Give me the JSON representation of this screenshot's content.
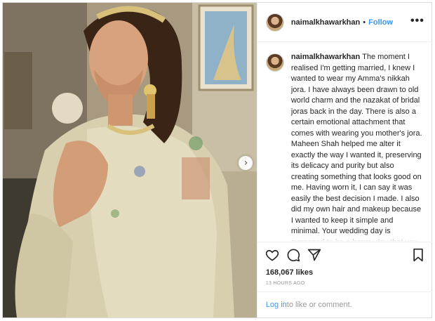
{
  "post": {
    "username": "naimalkhawarkhan",
    "follow_label": "Follow",
    "separator": "•",
    "more_label": "•••",
    "caption": "The moment I realised I'm getting married, I knew I wanted to wear my Amma's nikkah jora. I have always been drawn to old world charm and the nazakat of bridal joras back in the day. There is also a certain emotional attachment that comes with wearing you mother's jora. Maheen Shah helped me alter it exactly the way I wanted it, preserving its delicacy and purity but also creating something that looks good on me. Having worn it, I can say it was easily the best decision I made. I also did my own hair and makeup because I wanted to keep it simple and minimal. Your wedding day is supposed to be a happy day that you can truly enjoy. It's okay if you don't",
    "likes": "168,067 likes",
    "timestamp": "13 HOURS AGO",
    "login_link": "Log in",
    "login_suffix": " to like or comment."
  },
  "icons": {
    "like": "heart-icon",
    "comment": "comment-icon",
    "share": "share-icon",
    "save": "bookmark-icon",
    "next": "chevron-right-icon"
  },
  "colors": {
    "link": "#3897f0",
    "text": "#262626",
    "muted": "#999999",
    "border": "#dbdbdb"
  },
  "carousel": {
    "next_glyph": "›"
  }
}
